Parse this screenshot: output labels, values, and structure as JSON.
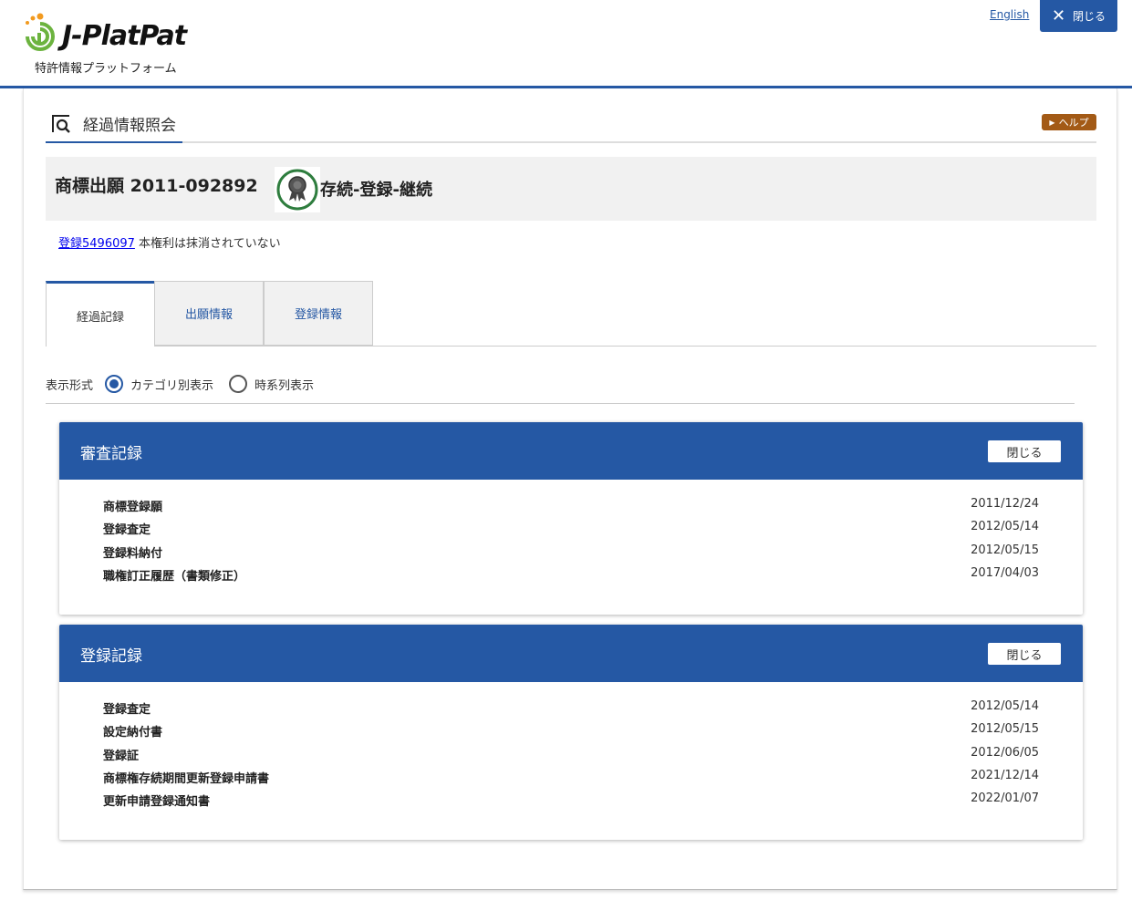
{
  "header": {
    "logo_text": "J-PlatPat",
    "logo_subtitle": "特許情報プラットフォーム",
    "english_link": "English",
    "close_label": "閉じる"
  },
  "page": {
    "title": "経過情報照会",
    "help_label": "ヘルプ"
  },
  "application": {
    "title": "商標出願 2011-092892",
    "status": "存続-登録-継続",
    "registration_link": "登録5496097",
    "registration_note": "本権利は抹消されていない"
  },
  "tabs": [
    {
      "label": "経過記録",
      "active": true
    },
    {
      "label": "出願情報",
      "active": false
    },
    {
      "label": "登録情報",
      "active": false
    }
  ],
  "display_format": {
    "label": "表示形式",
    "options": [
      {
        "label": "カテゴリ別表示",
        "checked": true
      },
      {
        "label": "時系列表示",
        "checked": false
      }
    ]
  },
  "sections": [
    {
      "title": "審査記録",
      "close_label": "閉じる",
      "rows": [
        {
          "name": "商標登録願",
          "date": "2011/12/24"
        },
        {
          "name": "登録査定",
          "date": "2012/05/14"
        },
        {
          "name": "登録料納付",
          "date": "2012/05/15"
        },
        {
          "name": "職権訂正履歴（書類修正）",
          "date": "2017/04/03"
        }
      ]
    },
    {
      "title": "登録記録",
      "close_label": "閉じる",
      "rows": [
        {
          "name": "登録査定",
          "date": "2012/05/14"
        },
        {
          "name": "設定納付書",
          "date": "2012/05/15"
        },
        {
          "name": "登録証",
          "date": "2012/06/05"
        },
        {
          "name": "商標権存続期間更新登録申請書",
          "date": "2021/12/14"
        },
        {
          "name": "更新申請登録通知書",
          "date": "2022/01/07"
        }
      ]
    }
  ],
  "colors": {
    "primary": "#2558a4",
    "help": "#a35a16",
    "logo_orange": "#f29a1f",
    "logo_green": "#6cb33f",
    "status_green": "#2e7d3e"
  }
}
